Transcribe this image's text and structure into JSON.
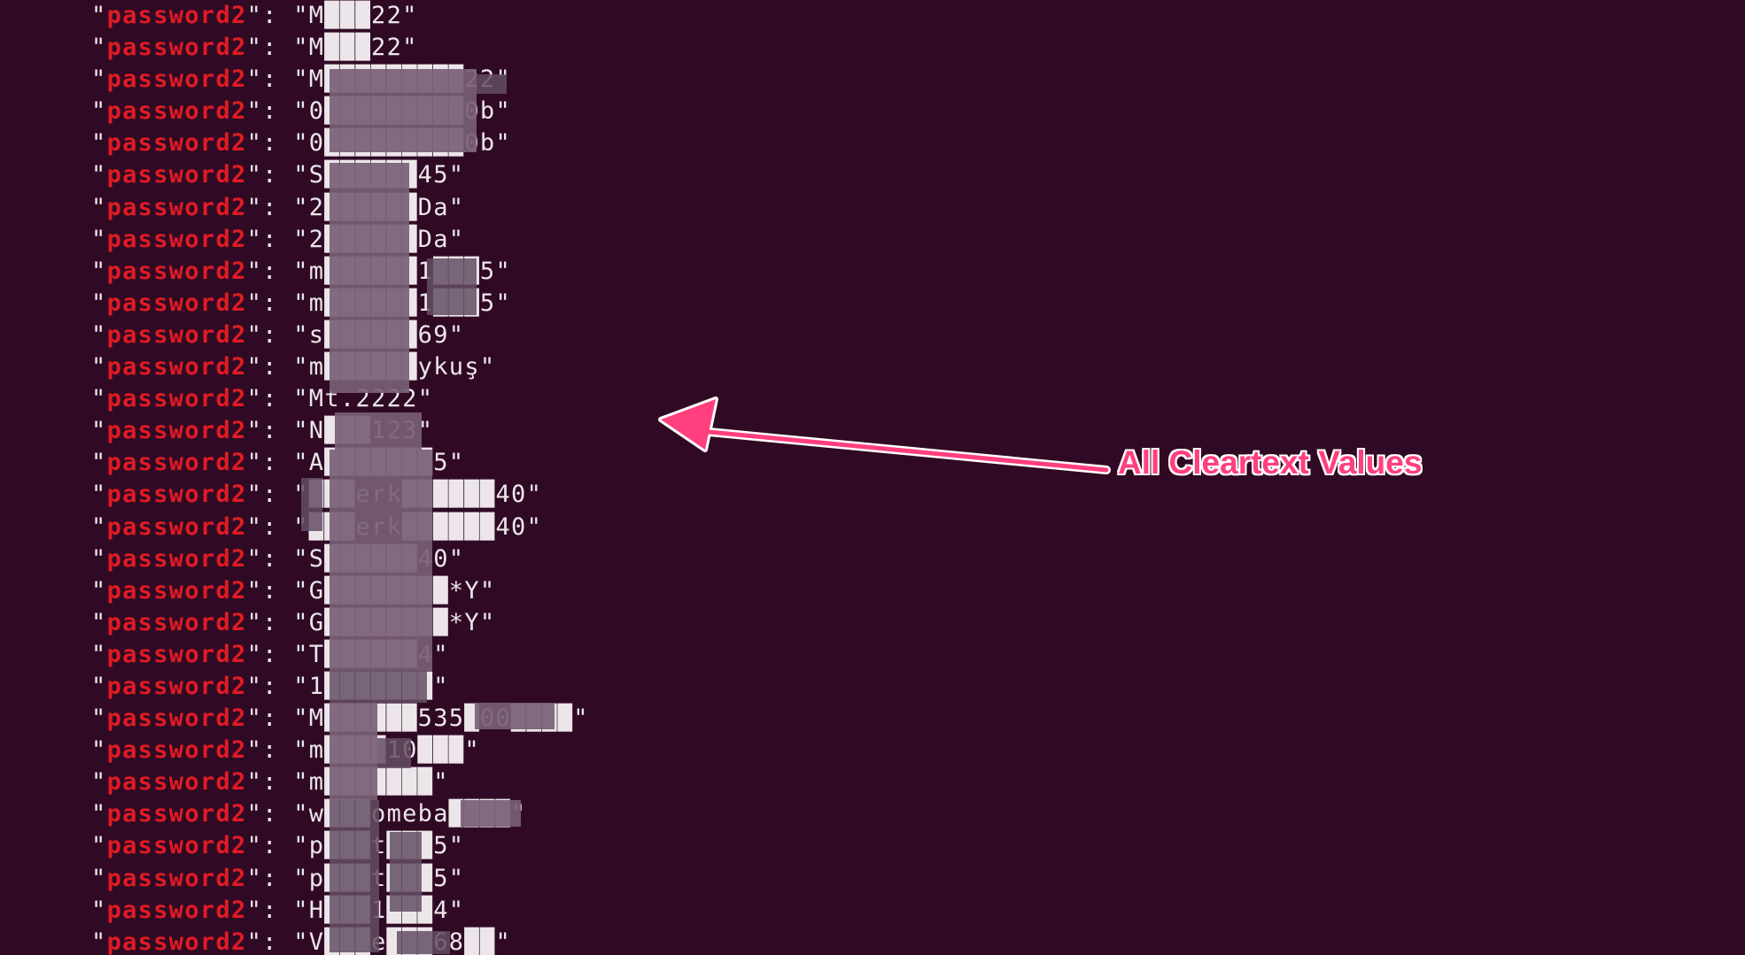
{
  "terminal": {
    "key_name": "password2",
    "values": [
      "M███22",
      "M███22",
      "M█████████22",
      "0█████████0b",
      "0█████████0b",
      "S██████45",
      "2██████Da",
      "2██████Da",
      "m██████1███5",
      "m██████1███5",
      "s██████69",
      "m██████ykuş",
      "Mt.2222",
      "N███123",
      "A███████5",
      "███erk██████40",
      "███erk██████40",
      "S██████40",
      "G████████*Y",
      "G████████*Y",
      "T██████4",
      "1███████",
      "M██████535█00████",
      "m████10███",
      "m███████",
      "w███omeba████",
      "p███t███5",
      "p███t███5",
      "H███1███4",
      "V███e███68██"
    ]
  },
  "annotation": {
    "label": "All Cleartext Values",
    "color": "#ff3f7e"
  },
  "colors": {
    "background": "#300a24",
    "key": "#e01b24",
    "text": "#ece6ea"
  }
}
